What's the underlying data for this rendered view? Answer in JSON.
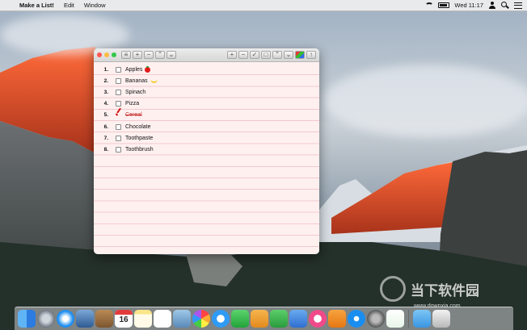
{
  "menubar": {
    "app_name": "Make a List!",
    "menus": [
      "Edit",
      "Window"
    ],
    "clock": "Wed 11:17"
  },
  "window": {
    "items": [
      {
        "num": "1.",
        "text": "Apples",
        "done": false,
        "emoji": "tomato-icon"
      },
      {
        "num": "2.",
        "text": "Bananas",
        "done": false,
        "emoji": "banana-icon"
      },
      {
        "num": "3.",
        "text": "Spinach",
        "done": false
      },
      {
        "num": "4.",
        "text": "Pizza",
        "done": false
      },
      {
        "num": "5.",
        "text": "Cereal",
        "done": true
      },
      {
        "num": "6.",
        "text": "Chocolate",
        "done": false
      },
      {
        "num": "7.",
        "text": "Toothpaste",
        "done": false
      },
      {
        "num": "8.",
        "text": "Toothbrush",
        "done": false
      }
    ],
    "toolbar_left": [
      "list-view-icon",
      "add-icon",
      "remove-icon",
      "move-up-icon",
      "move-down-icon"
    ],
    "toolbar_right": [
      "add-icon",
      "remove-icon",
      "check-icon",
      "uncheck-icon",
      "move-up-icon",
      "move-down-icon",
      "color-icon",
      "share-icon"
    ],
    "paper_color": "#fff0f0",
    "line_color": "#f2c9cc",
    "check_color": "#d21414"
  },
  "dock": {
    "calendar_day": "16",
    "apps": [
      "finder",
      "launchpad",
      "safari",
      "mail-stamp",
      "contacts",
      "calendar",
      "notes",
      "reminders",
      "preview",
      "photos",
      "messages",
      "facetime",
      "pages",
      "numbers",
      "keynote",
      "itunes",
      "ibooks",
      "app-store",
      "system-preferences",
      "make-a-list"
    ],
    "trailing": [
      "downloads-folder",
      "trash"
    ]
  },
  "watermark": {
    "text": "当下软件园",
    "url": "www.downxia.com"
  }
}
